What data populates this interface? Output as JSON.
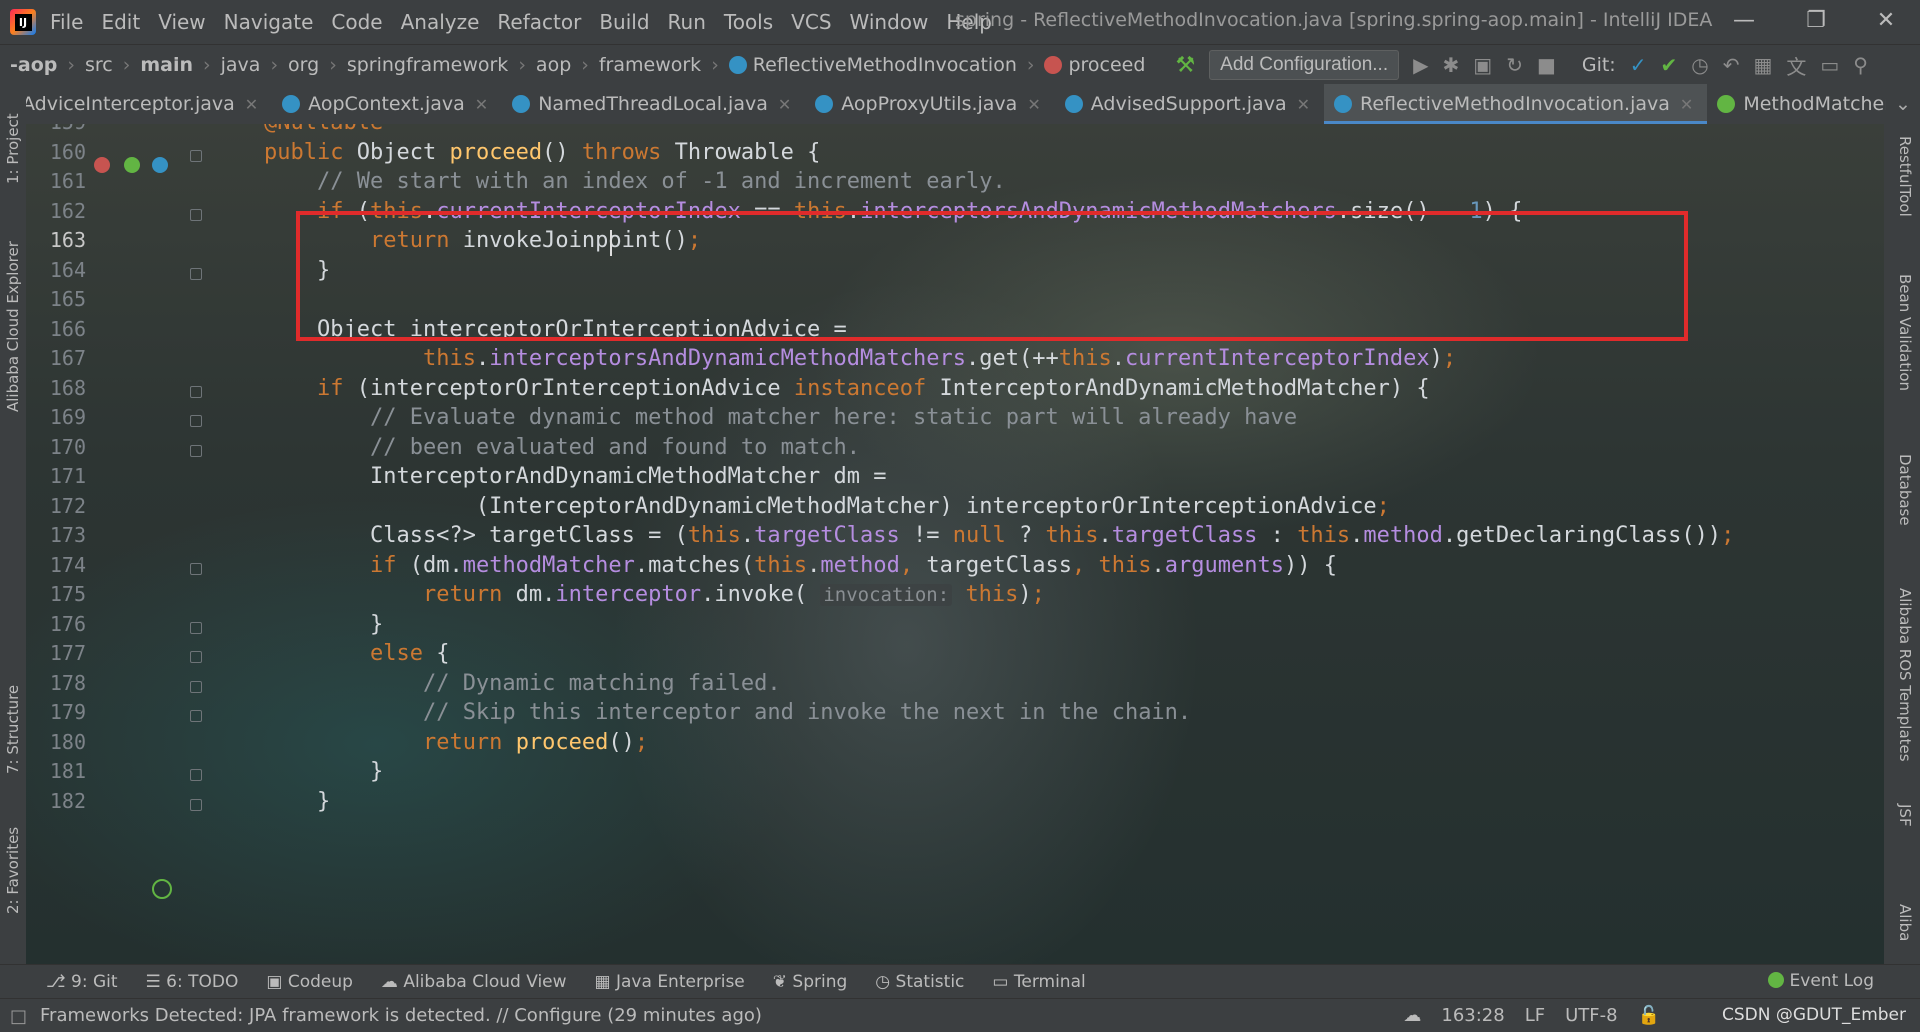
{
  "window": {
    "title": "spring - ReflectiveMethodInvocation.java [spring.spring-aop.main] - IntelliJ IDEA",
    "menu": [
      "File",
      "Edit",
      "View",
      "Navigate",
      "Code",
      "Analyze",
      "Refactor",
      "Build",
      "Run",
      "Tools",
      "VCS",
      "Window",
      "Help"
    ]
  },
  "breadcrumb": [
    "-aop",
    "src",
    "main",
    "java",
    "org",
    "springframework",
    "aop",
    "framework",
    "ReflectiveMethodInvocation",
    "proceed"
  ],
  "toolbar": {
    "add_config": "Add Configuration...",
    "git_label": "Git:"
  },
  "tabs": [
    {
      "label": "AdviceInterceptor.java",
      "kind": "class"
    },
    {
      "label": "AopContext.java",
      "kind": "class"
    },
    {
      "label": "NamedThreadLocal.java",
      "kind": "class"
    },
    {
      "label": "AopProxyUtils.java",
      "kind": "class"
    },
    {
      "label": "AdvisedSupport.java",
      "kind": "class"
    },
    {
      "label": "ReflectiveMethodInvocation.java",
      "kind": "class",
      "active": true
    },
    {
      "label": "MethodMatcher.java",
      "kind": "interface"
    }
  ],
  "left_tools": [
    "1: Project",
    "Alibaba Cloud Explorer",
    "7: Structure",
    "2: Favorites"
  ],
  "right_tools": [
    "RestfulTool",
    "Bean Validation",
    "Database",
    "Alibaba ROS Templates",
    "JSF",
    "Aliba"
  ],
  "editor": {
    "current_line": 163,
    "lines": [
      {
        "no": 159,
        "html": "<span class=\"kw\">@Nullable</span>"
      },
      {
        "no": 160,
        "html": "<span class=\"kw\">public</span> Object <span class=\"fn\">proceed</span>() <span class=\"kw\">throws</span> Throwable {"
      },
      {
        "no": 161,
        "html": "    <span class=\"cmt\">// We start with an index of -1 and increment early.</span>"
      },
      {
        "no": 162,
        "html": "    <span class=\"kw\">if</span> (<span class=\"kw\">this</span>.<span class=\"fld\">currentInterceptorIndex</span> == <span class=\"kw\">this</span>.<span class=\"fld\">interceptorsAndDynamicMethodMatchers</span>.size() - <span class=\"num\">1</span>) {"
      },
      {
        "no": 163,
        "html": "        <span class=\"kw\">return</span> invokeJoinpoint()<span class=\"kw\">;</span>"
      },
      {
        "no": 164,
        "html": "    }"
      },
      {
        "no": 165,
        "html": ""
      },
      {
        "no": 166,
        "html": "    Object interceptorOrInterceptionAdvice ="
      },
      {
        "no": 167,
        "html": "            <span class=\"kw\">this</span>.<span class=\"fld\">interceptorsAndDynamicMethodMatchers</span>.get(++<span class=\"kw\">this</span>.<span class=\"fld\">currentInterceptorIndex</span>)<span class=\"kw\">;</span>"
      },
      {
        "no": 168,
        "html": "    <span class=\"kw\">if</span> (interceptorOrInterceptionAdvice <span class=\"kw\">instanceof</span> InterceptorAndDynamicMethodMatcher) {"
      },
      {
        "no": 169,
        "html": "        <span class=\"cmt\">// Evaluate dynamic method matcher here: static part will already have</span>"
      },
      {
        "no": 170,
        "html": "        <span class=\"cmt\">// been evaluated and found to match.</span>"
      },
      {
        "no": 171,
        "html": "        InterceptorAndDynamicMethodMatcher dm ="
      },
      {
        "no": 172,
        "html": "                (InterceptorAndDynamicMethodMatcher) interceptorOrInterceptionAdvice<span class=\"kw\">;</span>"
      },
      {
        "no": 173,
        "html": "        Class&lt;?&gt; targetClass = (<span class=\"kw\">this</span>.<span class=\"fld\">targetClass</span> != <span class=\"kw\">null</span> ? <span class=\"kw\">this</span>.<span class=\"fld\">targetClass</span> : <span class=\"kw\">this</span>.<span class=\"fld\">method</span>.getDeclaringClass())<span class=\"kw\">;</span>"
      },
      {
        "no": 174,
        "html": "        <span class=\"kw\">if</span> (dm.<span class=\"fld\">methodMatcher</span>.matches(<span class=\"kw\">this</span>.<span class=\"fld\">method</span><span class=\"kw\">,</span> targetClass<span class=\"kw\">,</span> <span class=\"kw\">this</span>.<span class=\"fld\">arguments</span>)) {"
      },
      {
        "no": 175,
        "html": "            <span class=\"kw\">return</span> dm.<span class=\"fld\">interceptor</span>.invoke( <span class=\"hint\">invocation:</span> <span class=\"kw\">this</span>)<span class=\"kw\">;</span>"
      },
      {
        "no": 176,
        "html": "        }"
      },
      {
        "no": 177,
        "html": "        <span class=\"kw\">else</span> {"
      },
      {
        "no": 178,
        "html": "            <span class=\"cmt\">// Dynamic matching failed.</span>"
      },
      {
        "no": 179,
        "html": "            <span class=\"cmt\">// Skip this interceptor and invoke the next in the chain.</span>"
      },
      {
        "no": 180,
        "html": "            <span class=\"kw\">return</span> <span class=\"fn\">proceed</span>()<span class=\"kw\">;</span>"
      },
      {
        "no": 181,
        "html": "        }"
      },
      {
        "no": 182,
        "html": "    }"
      }
    ]
  },
  "toolwindows": [
    {
      "label": "9: Git",
      "icon": "git-branch-icon"
    },
    {
      "label": "6: TODO",
      "icon": "list-icon"
    },
    {
      "label": "Codeup",
      "icon": "codeup-icon"
    },
    {
      "label": "Alibaba Cloud View",
      "icon": "cloud-icon"
    },
    {
      "label": "Java Enterprise",
      "icon": "enterprise-icon"
    },
    {
      "label": "Spring",
      "icon": "spring-leaf-icon"
    },
    {
      "label": "Statistic",
      "icon": "statistic-icon"
    },
    {
      "label": "Terminal",
      "icon": "terminal-icon"
    }
  ],
  "event_log": "Event Log",
  "status": {
    "message": "Frameworks Detected: JPA framework is detected. // Configure (29 minutes ago)",
    "position": "163:28",
    "line_sep": "LF",
    "encoding": "UTF-8",
    "watermark": "CSDN @GDUT_Ember"
  },
  "colors": {
    "highlight_box": "#e02b2b",
    "accent": "#4a88c7",
    "keyword": "#cc7832",
    "field": "#b58de0",
    "method": "#ffc66d"
  }
}
